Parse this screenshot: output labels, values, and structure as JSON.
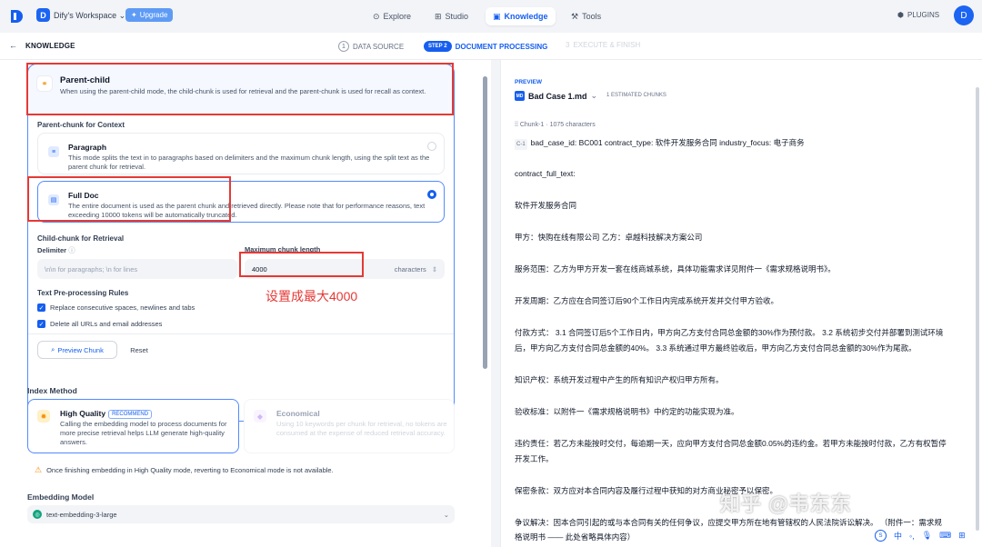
{
  "colors": {
    "accent": "#155eef",
    "annotation": "#e53935",
    "warning": "#f79009"
  },
  "workspace": {
    "initial": "D",
    "name": "Dify's Workspace",
    "upgrade": "Upgrade"
  },
  "nav": {
    "explore": "Explore",
    "studio": "Studio",
    "knowledge": "Knowledge",
    "tools": "Tools",
    "plugins": "PLUGINS",
    "user_initial": "D"
  },
  "steps": {
    "back_title": "KNOWLEDGE",
    "s1_num": "1",
    "s1": "DATA SOURCE",
    "s2_pill": "STEP 2",
    "s2": "DOCUMENT PROCESSING",
    "s3_num": "3",
    "s3": "EXECUTE & FINISH"
  },
  "segment": {
    "parent_child_title": "Parent-child",
    "parent_child_desc": "When using the parent-child mode, the child-chunk is used for retrieval and the parent-chunk is used for recall as context.",
    "parent_label": "Parent-chunk for Context",
    "paragraph_title": "Paragraph",
    "paragraph_desc": "This mode splits the text in to paragraphs based on delimiters and the maximum chunk length, using the split text as the parent chunk for retrieval.",
    "fulldoc_title": "Full Doc",
    "fulldoc_desc": "The entire document is used as the parent chunk and retrieved directly. Please note that for performance reasons, text exceeding 10000 tokens will be automatically truncated.",
    "child_label": "Child-chunk for Retrieval",
    "delimiter_label": "Delimiter",
    "delimiter_placeholder": "\\n\\n for paragraphs; \\n for lines",
    "maxlen_label": "Maximum chunk length",
    "maxlen_value": "4000",
    "maxlen_unit": "characters",
    "rules_label": "Text Pre-processing Rules",
    "rule1": "Replace consecutive spaces, newlines and tabs",
    "rule2": "Delete all URLs and email addresses",
    "preview_btn": "Preview Chunk",
    "reset_btn": "Reset"
  },
  "annotation": "设置成最大4000",
  "index": {
    "title": "Index Method",
    "hq_title": "High Quality",
    "hq_badge": "RECOMMEND",
    "hq_desc": "Calling the embedding model to process documents for more precise retrieval helps LLM generate high-quality answers.",
    "eco_title": "Economical",
    "eco_desc": "Using 10 keywords per chunk for retrieval, no tokens are consumed at the expense of reduced retrieval accuracy.",
    "warning": "Once finishing embedding in High Quality mode, reverting to Economical mode is not available."
  },
  "embedding": {
    "title": "Embedding Model",
    "model": "text-embedding-3-large"
  },
  "preview": {
    "label": "PREVIEW",
    "file": "Bad Case 1.md",
    "file_badge": "MD",
    "count": "1 ESTIMATED CHUNKS",
    "chunk_id": "Chunk-1",
    "chunk_chars": "1075 characters",
    "c1_tag": "C-1",
    "lines": [
      "bad_case_id: BC001 contract_type: 软件开发服务合同 industry_focus: 电子商务",
      "contract_full_text:",
      "软件开发服务合同",
      "甲方：快购在线有限公司 乙方：卓越科技解决方案公司",
      "服务范围：乙方为甲方开发一套在线商城系统，具体功能需求详见附件一《需求规格说明书》。",
      "开发周期：乙方应在合同签订后90个工作日内完成系统开发并交付甲方验收。",
      "付款方式： 3.1 合同签订后5个工作日内，甲方向乙方支付合同总金额的30%作为预付款。 3.2 系统初步交付并部署到测试环境",
      "后，甲方向乙方支付合同总金额的40%。 3.3 系统通过甲方最终验收后，甲方向乙方支付合同总金额的30%作为尾款。",
      "知识产权：系统开发过程中产生的所有知识产权归甲方所有。",
      "验收标准：以附件一《需求规格说明书》中约定的功能实现为准。",
      "违约责任：若乙方未能按时交付，每逾期一天，应向甲方支付合同总金额0.05%的违约金。若甲方未能按时付款，乙方有权暂停",
      "开发工作。",
      "保密条款：双方应对本合同内容及履行过程中获知的对方商业秘密予以保密。",
      "争议解决：因本合同引起的或与本合同有关的任何争议，应提交甲方所在地有管辖权的人民法院诉讼解决。 （附件一：需求规",
      "格说明书 —— 此处省略具体内容）"
    ]
  },
  "watermark": "知乎 @韦东东",
  "tray": {
    "ime": "中"
  }
}
